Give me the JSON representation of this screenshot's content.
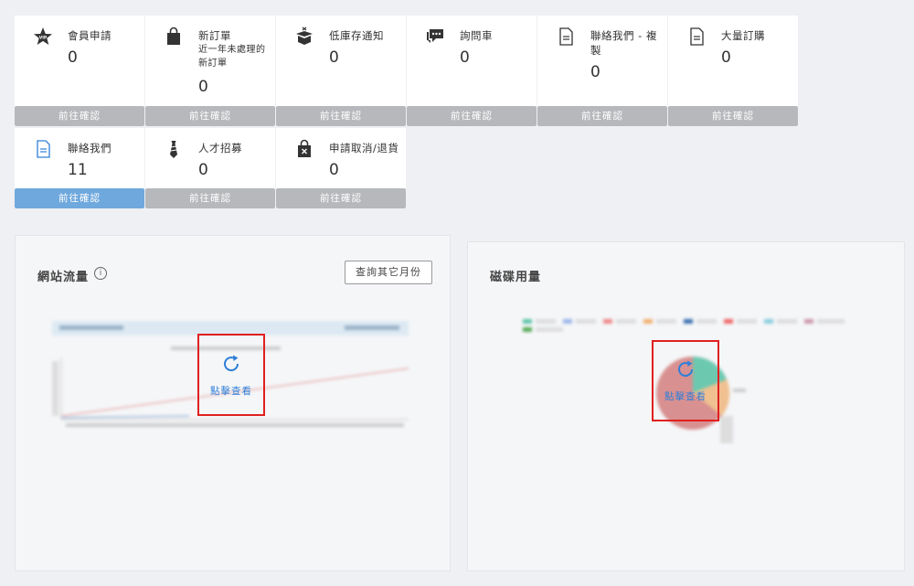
{
  "cards": [
    {
      "title": "會員申請",
      "subtitle": "",
      "count": "0",
      "button": "前往確認",
      "icon": "vip-star-icon",
      "active": false
    },
    {
      "title": "新訂單",
      "subtitle": "近一年未處理的新訂單",
      "count": "0",
      "button": "前往確認",
      "icon": "shopping-bag-icon",
      "active": false
    },
    {
      "title": "低庫存通知",
      "subtitle": "",
      "count": "0",
      "button": "前往確認",
      "icon": "open-box-icon",
      "active": false
    },
    {
      "title": "詢問車",
      "subtitle": "",
      "count": "0",
      "button": "前往確認",
      "icon": "chat-bubble-icon",
      "active": false
    },
    {
      "title": "聯絡我們 - 複製",
      "subtitle": "",
      "count": "0",
      "button": "前往確認",
      "icon": "document-icon",
      "active": false
    },
    {
      "title": "大量訂購",
      "subtitle": "",
      "count": "0",
      "button": "前往確認",
      "icon": "document-icon",
      "active": false
    },
    {
      "title": "聯絡我們",
      "subtitle": "",
      "count": "11",
      "button": "前往確認",
      "icon": "document-icon",
      "active": true
    },
    {
      "title": "人才招募",
      "subtitle": "",
      "count": "0",
      "button": "前往確認",
      "icon": "necktie-icon",
      "active": false
    },
    {
      "title": "申請取消/退貨",
      "subtitle": "",
      "count": "0",
      "button": "前往確認",
      "icon": "cancel-bag-icon",
      "active": false
    }
  ],
  "traffic": {
    "title": "網站流量",
    "info": "i",
    "month_button": "查詢其它月份",
    "refresh_label": "點擊查看"
  },
  "disk": {
    "title": "磁碟用量",
    "refresh_label": "點擊查看"
  },
  "colors": {
    "card_button": "#b6b8bb",
    "card_button_active": "#6fa8dc",
    "refresh_blue": "#2f7fd8",
    "highlight_red": "#e02020"
  }
}
